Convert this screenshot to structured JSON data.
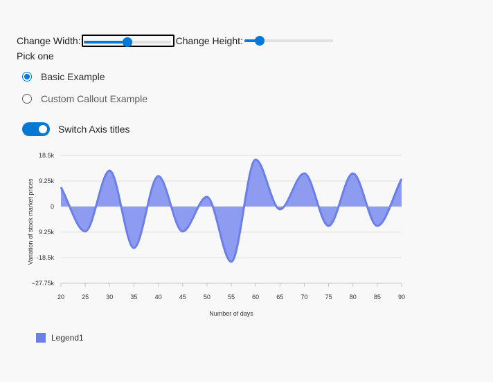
{
  "controls": {
    "width_label": "Change Width:",
    "height_label": "Change Height:",
    "width_value": 0.5,
    "height_value": 0.17
  },
  "pick": {
    "label": "Pick one",
    "options": [
      {
        "label": "Basic Example",
        "checked": true
      },
      {
        "label": "Custom Callout Example",
        "checked": false
      }
    ]
  },
  "toggle": {
    "label": "Switch Axis titles",
    "on": true
  },
  "colors": {
    "accent": "#0078d4",
    "series_line": "#6b7fe6",
    "series_fill": "#8d9cf0"
  },
  "chart_data": {
    "type": "area",
    "xlabel": "Number of days",
    "ylabel": "Variation of stock market prices",
    "xlim": [
      20,
      90
    ],
    "ylim": [
      -27750,
      18500
    ],
    "x_ticks": [
      "20",
      "25",
      "30",
      "35",
      "40",
      "45",
      "50",
      "55",
      "60",
      "65",
      "70",
      "75",
      "80",
      "85",
      "90"
    ],
    "y_ticks": [
      {
        "value": 18500,
        "label": "18.5k"
      },
      {
        "value": 9250,
        "label": "9.25k"
      },
      {
        "value": 0,
        "label": "0"
      },
      {
        "value": -9250,
        "label": "9.25k"
      },
      {
        "value": -18500,
        "label": "-18.5k"
      },
      {
        "value": -27750,
        "label": "−27.75k"
      }
    ],
    "grid": true,
    "legend": "bottom-left",
    "series": [
      {
        "name": "Legend1",
        "x": [
          20,
          25,
          30,
          35,
          40,
          45,
          50,
          55,
          60,
          65,
          70,
          75,
          80,
          85,
          90
        ],
        "y": [
          7000,
          -9000,
          13000,
          -15000,
          11000,
          -9000,
          3500,
          -20000,
          17000,
          -1000,
          12000,
          -7000,
          12000,
          -7000,
          10000
        ]
      }
    ]
  }
}
